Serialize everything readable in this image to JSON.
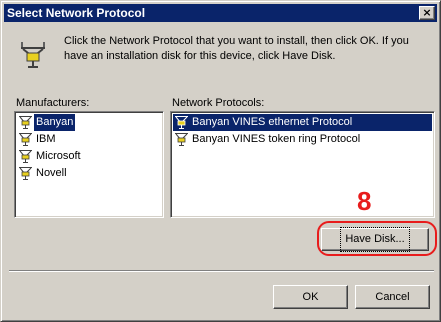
{
  "window": {
    "title": "Select Network Protocol",
    "close_glyph": "×"
  },
  "intro": {
    "text": "Click the Network Protocol that you want to install, then click OK. If you have an installation disk for this device, click Have Disk.",
    "icon": "network-protocol-icon"
  },
  "manufacturers": {
    "label": "Manufacturers:",
    "items": [
      {
        "label": "Banyan",
        "selected": true
      },
      {
        "label": "IBM",
        "selected": false
      },
      {
        "label": "Microsoft",
        "selected": false
      },
      {
        "label": "Novell",
        "selected": false
      }
    ]
  },
  "protocols": {
    "label": "Network Protocols:",
    "items": [
      {
        "label": "Banyan VINES ethernet Protocol",
        "selected": true
      },
      {
        "label": "Banyan VINES token ring Protocol",
        "selected": false
      }
    ]
  },
  "buttons": {
    "have_disk": "Have Disk...",
    "ok": "OK",
    "cancel": "Cancel"
  },
  "annotation": {
    "step_number": "8",
    "color": "#e81c1c"
  },
  "colors": {
    "titlebar": "#0a246a",
    "face": "#d4d0c8",
    "selection": "#0a246a"
  }
}
